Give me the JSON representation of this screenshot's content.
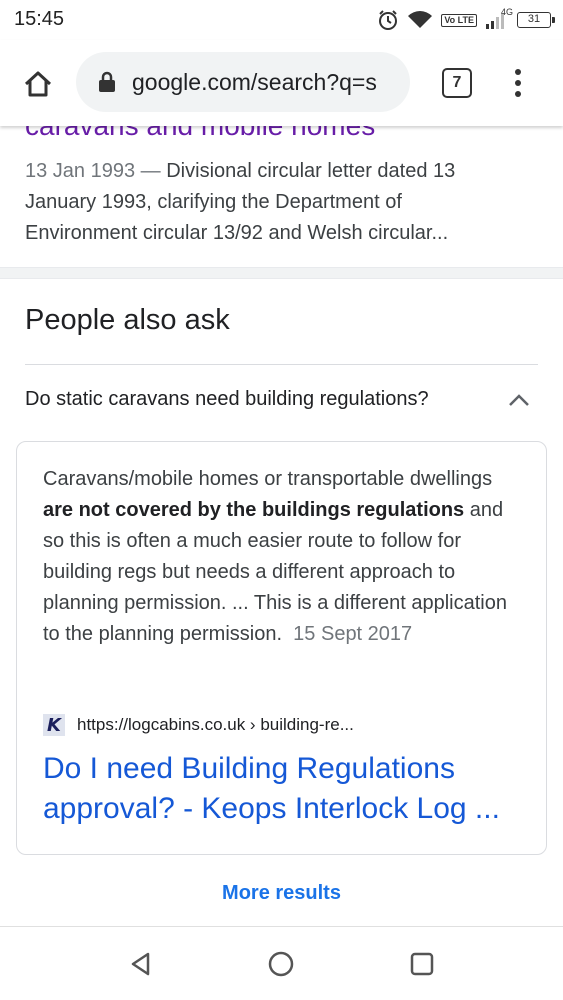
{
  "status_bar": {
    "time": "15:45",
    "network": "4G",
    "volte": "Vo LTE",
    "battery": "31"
  },
  "browser": {
    "url": "google.com/search?q=s",
    "tab_count": "7"
  },
  "previous_result": {
    "title_fragment": "caravans and mobile homes",
    "date": "13 Jan 1993",
    "separator": " — ",
    "snippet": "Divisional circular letter dated 13 January 1993, clarifying the Department of Environment circular 13/92 and Welsh circular..."
  },
  "people_also_ask": {
    "heading": "People also ask",
    "question": "Do static caravans need building regulations?",
    "answer": {
      "text_1": "Caravans/mobile homes or transportable dwellings ",
      "bold": "are not covered by the buildings regulations",
      "text_2": " and so this is often a much easier route to follow for building regs but needs a different approach to planning permission. ... This is a different application to the planning permission.",
      "date": "15 Sept 2017",
      "favicon_letter": "K",
      "source_url": "https://logcabins.co.uk › building-re...",
      "link_title": "Do I need Building Regulations approval? - Keops Interlock Log ..."
    },
    "more_results": "More results"
  },
  "colors": {
    "link": "#1558d6",
    "visited_title": "#681da8",
    "more_results": "#1a73e8"
  }
}
